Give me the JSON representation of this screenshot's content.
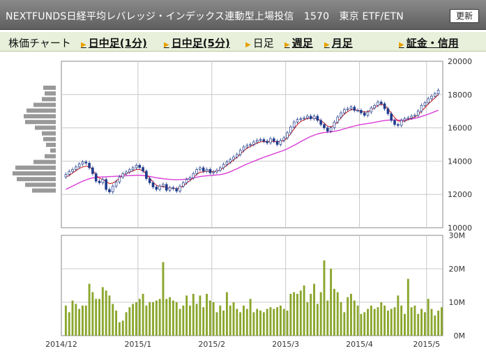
{
  "window": {
    "title": "NEXTFUNDS日経平均レバレッジ・インデックス連動型上場投信　1570　東京 ETF/ETN",
    "refresh_label": "更新"
  },
  "tabs": [
    {
      "label": "株価チャート",
      "link": false
    },
    {
      "label": "日中足(1分)",
      "link": true
    },
    {
      "label": "日中足(5分)",
      "link": true
    },
    {
      "label": "日足",
      "link": false
    },
    {
      "label": "週足",
      "link": true
    },
    {
      "label": "月足",
      "link": true
    },
    {
      "label": "証金・信用",
      "link": true
    }
  ],
  "chart_data": {
    "type": "candlestick+bar",
    "x_ticks": [
      "2014/12",
      "2015/1",
      "2015/2",
      "2015/3",
      "2015/4",
      "2015/5"
    ],
    "price_axis": {
      "ticks": [
        "20000",
        "18000",
        "16000",
        "14000",
        "12000",
        "10000"
      ],
      "range": [
        10000,
        20000
      ]
    },
    "volume_axis": {
      "ticks": [
        "30M",
        "20M",
        "10M",
        "0M"
      ],
      "range": [
        0,
        30
      ]
    },
    "colors": {
      "up": "#ffffff",
      "down": "#1f3c8c",
      "ma_short": "#cc1010",
      "ma_long": "#d93cd6",
      "volume": "#8aa62c",
      "profile": "#999999",
      "grid": "#c8c8c8"
    },
    "close": [
      13200,
      13380,
      13500,
      13650,
      13820,
      13950,
      13880,
      13600,
      13250,
      12800,
      12700,
      12900,
      12300,
      12150,
      12500,
      12750,
      13050,
      13250,
      13350,
      13480,
      13600,
      13750,
      13620,
      13400,
      12950,
      12700,
      12450,
      12300,
      12500,
      12600,
      12250,
      12400,
      12350,
      12200,
      12500,
      12700,
      12900,
      13000,
      13250,
      13500,
      13600,
      13400,
      13500,
      13300,
      13350,
      13450,
      13600,
      13800,
      13950,
      14100,
      14250,
      14400,
      14650,
      14850,
      14950,
      15000,
      15150,
      15250,
      15300,
      15200,
      15100,
      15350,
      15200,
      15000,
      15250,
      15400,
      15700,
      16050,
      16350,
      16500,
      16550,
      16600,
      16700,
      16550,
      16700,
      16450,
      16200,
      16000,
      15800,
      16000,
      16350,
      16650,
      16900,
      17100,
      17150,
      17250,
      17050,
      17050,
      16900,
      16750,
      16950,
      17200,
      17350,
      17550,
      17450,
      17150,
      16850,
      16450,
      16200,
      16150,
      16450,
      16550,
      16600,
      16700,
      16750,
      17000,
      17350,
      17500,
      17750,
      17900,
      18050,
      18250
    ],
    "ma_short": [
      13050,
      13130,
      13280,
      13420,
      13560,
      13650,
      13700,
      13670,
      13480,
      13150,
      12980,
      12900,
      12780,
      12650,
      12680,
      12800,
      12980,
      13140,
      13240,
      13330,
      13420,
      13500,
      13500,
      13420,
      13220,
      12980,
      12750,
      12550,
      12480,
      12480,
      12400,
      12380,
      12380,
      12340,
      12400,
      12500,
      12680,
      12830,
      13000,
      13200,
      13330,
      13350,
      13400,
      13380,
      13360,
      13400,
      13480,
      13600,
      13750,
      13900,
      14070,
      14230,
      14420,
      14620,
      14780,
      14880,
      14980,
      15080,
      15160,
      15180,
      15150,
      15200,
      15180,
      15150,
      15180,
      15230,
      15400,
      15650,
      15930,
      16200,
      16380,
      16480,
      16570,
      16580,
      16600,
      16540,
      16430,
      16280,
      16100,
      16060,
      16150,
      16350,
      16600,
      16830,
      16980,
      17090,
      17100,
      17050,
      17000,
      16950,
      16970,
      17070,
      17200,
      17350,
      17420,
      17340,
      17150,
      16880,
      16620,
      16420,
      16380,
      16400,
      16500,
      16580,
      16650,
      16780,
      17000,
      17200,
      17430,
      17620,
      17800,
      18000
    ],
    "ma_long": [
      12300,
      12400,
      12500,
      12600,
      12700,
      12790,
      12870,
      12940,
      12990,
      13020,
      13040,
      13050,
      13060,
      13070,
      13080,
      13090,
      13100,
      13110,
      13120,
      13130,
      13140,
      13150,
      13150,
      13140,
      13110,
      13080,
      13040,
      13000,
      12970,
      12940,
      12920,
      12900,
      12890,
      12880,
      12890,
      12900,
      12920,
      12950,
      12990,
      13030,
      13070,
      13100,
      13120,
      13130,
      13150,
      13170,
      13190,
      13230,
      13290,
      13360,
      13450,
      13540,
      13640,
      13740,
      13830,
      13910,
      13990,
      14070,
      14150,
      14230,
      14300,
      14370,
      14440,
      14510,
      14580,
      14650,
      14740,
      14840,
      14950,
      15060,
      15170,
      15280,
      15390,
      15480,
      15560,
      15630,
      15680,
      15720,
      15740,
      15760,
      15790,
      15830,
      15880,
      15940,
      16000,
      16060,
      16110,
      16160,
      16200,
      16230,
      16260,
      16290,
      16330,
      16370,
      16410,
      16440,
      16460,
      16470,
      16470,
      16460,
      16460,
      16470,
      16500,
      16530,
      16570,
      16620,
      16680,
      16750,
      16820,
      16900,
      16980,
      17060
    ],
    "volume_m": [
      9,
      7,
      10.5,
      9.5,
      8,
      9,
      9,
      15.5,
      13,
      11,
      11,
      14.5,
      13.5,
      12,
      9.5,
      7.5,
      4,
      4.5,
      7,
      8.5,
      9.5,
      10,
      11,
      12.5,
      9,
      10,
      10,
      10.5,
      11,
      22,
      11,
      11.5,
      10.5,
      10,
      8,
      9,
      12,
      9,
      12.5,
      9.5,
      12,
      8.5,
      12.5,
      10.5,
      10,
      7,
      9,
      7.5,
      13,
      9,
      10,
      8,
      7,
      9,
      8,
      11,
      7,
      8,
      7.5,
      7,
      8,
      8.5,
      8,
      8.5,
      9,
      8,
      7.5,
      12.5,
      13,
      12.5,
      13.5,
      15,
      10,
      12.5,
      15.5,
      9.5,
      13,
      22.5,
      10.5,
      20,
      14,
      13,
      10,
      7,
      11.5,
      12.5,
      10.5,
      9,
      6.5,
      7,
      8,
      9,
      8,
      8.5,
      10,
      9,
      7.5,
      8,
      8.5,
      12,
      9,
      6.5,
      17,
      8.5,
      9,
      6.5,
      8,
      7,
      11,
      8,
      6,
      7.5,
      8.5
    ],
    "profile": [
      0.18,
      0.16,
      0.2,
      0.32,
      0.42,
      0.46,
      0.44,
      0.3,
      0.2,
      0.18,
      0.14,
      0.08,
      0.16,
      0.32,
      0.58,
      0.62,
      0.56,
      0.44,
      0.34
    ]
  }
}
